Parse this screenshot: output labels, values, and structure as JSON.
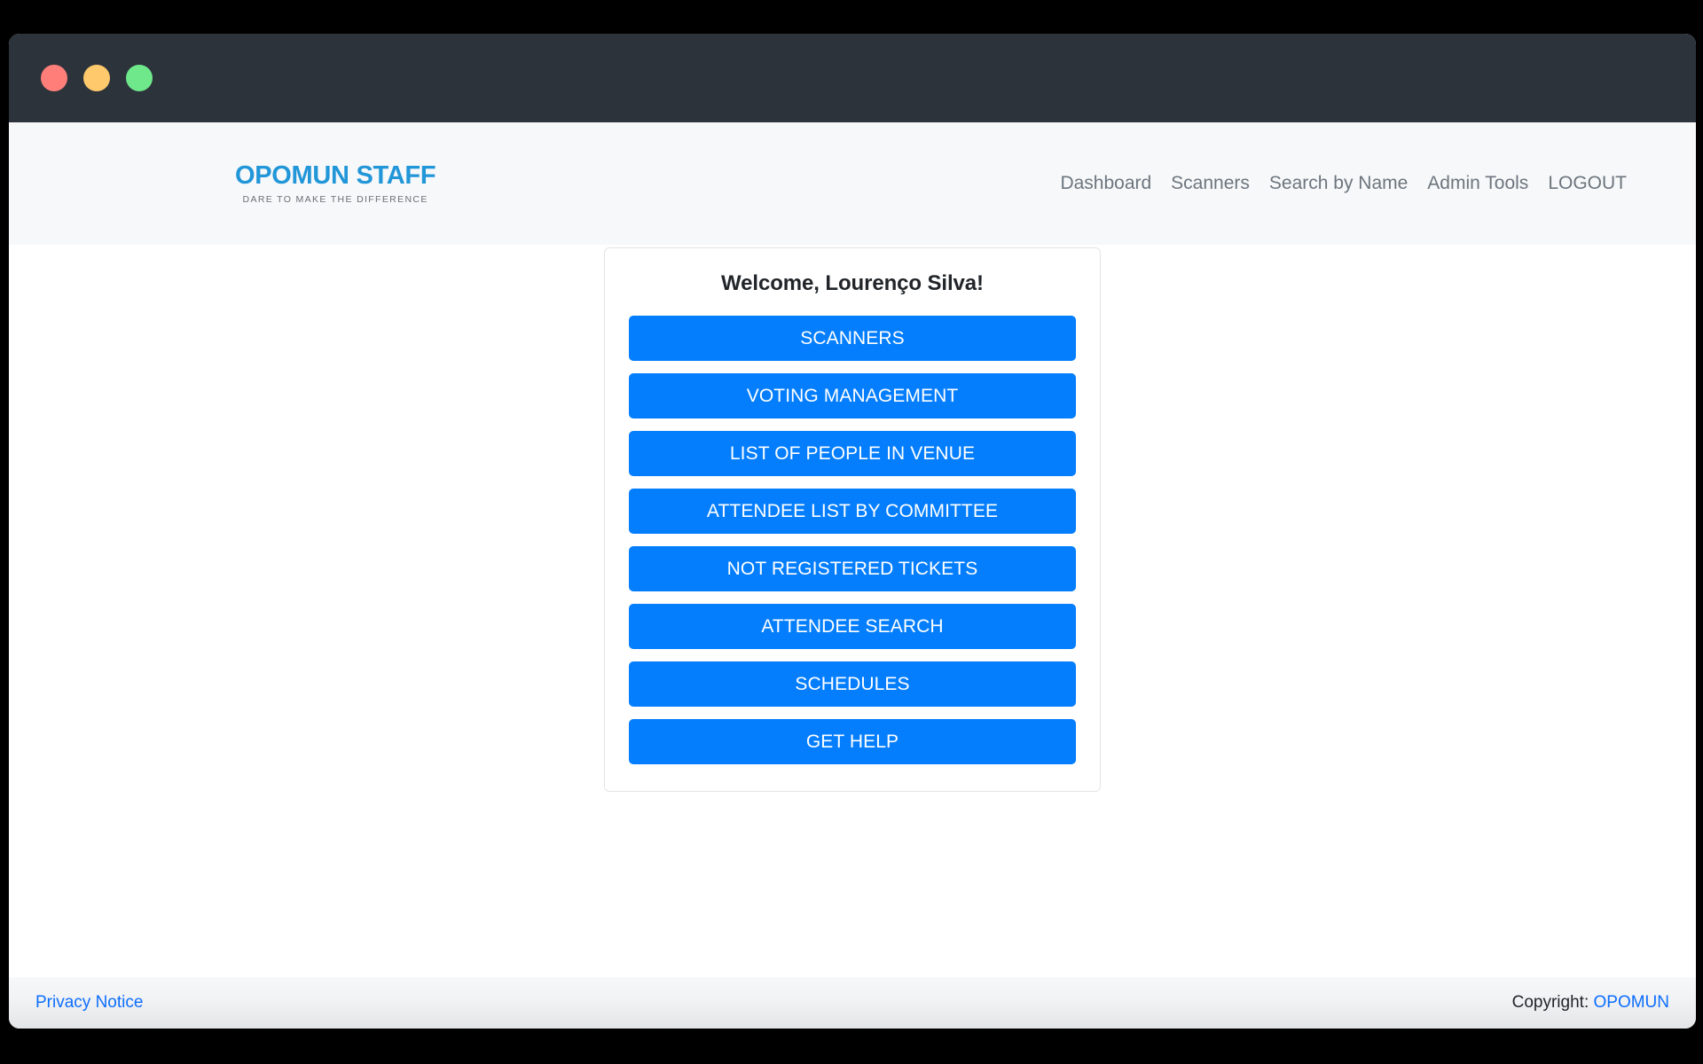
{
  "window": {
    "traffic_lights": [
      {
        "name": "close",
        "color": "#ff7e79"
      },
      {
        "name": "minimize",
        "color": "#ffc96c"
      },
      {
        "name": "maximize",
        "color": "#6fe88b"
      }
    ]
  },
  "header": {
    "brand": {
      "title": "OPOMUN STAFF",
      "tagline": "DARE TO MAKE THE DIFFERENCE",
      "color": "#2196d8"
    },
    "nav": [
      {
        "label": "Dashboard"
      },
      {
        "label": "Scanners"
      },
      {
        "label": "Search by Name"
      },
      {
        "label": "Admin Tools"
      },
      {
        "label": "LOGOUT"
      }
    ]
  },
  "main": {
    "card": {
      "welcome": "Welcome, Lourenço Silva!",
      "buttons": [
        {
          "label": "SCANNERS"
        },
        {
          "label": "VOTING MANAGEMENT"
        },
        {
          "label": "LIST OF PEOPLE IN VENUE"
        },
        {
          "label": "ATTENDEE LIST BY COMMITTEE"
        },
        {
          "label": "NOT REGISTERED TICKETS"
        },
        {
          "label": "ATTENDEE SEARCH"
        },
        {
          "label": "SCHEDULES"
        },
        {
          "label": "GET HELP"
        }
      ],
      "button_color": "#047efd"
    }
  },
  "footer": {
    "privacy_label": "Privacy Notice",
    "copyright_prefix": "Copyright: ",
    "copyright_link": "OPOMUN",
    "link_color": "#0d6efd"
  }
}
